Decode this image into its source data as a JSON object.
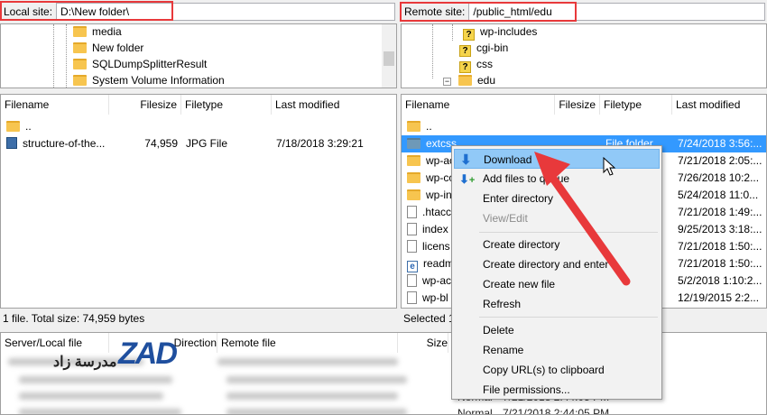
{
  "local_site": {
    "label": "Local site:",
    "path": "D:\\New folder\\"
  },
  "remote_site": {
    "label": "Remote site:",
    "path": "/public_html/edu"
  },
  "local_tree": [
    "media",
    "New folder",
    "SQLDumpSplitterResult",
    "System Volume Information"
  ],
  "remote_tree": [
    "wp-includes",
    "cgi-bin",
    "css",
    "edu"
  ],
  "local_list": {
    "columns": [
      "Filename",
      "Filesize",
      "Filetype",
      "Last modified"
    ],
    "rows": [
      {
        "name": "..",
        "size": "",
        "type": "",
        "modified": ""
      },
      {
        "name": "structure-of-the...",
        "size": "74,959",
        "type": "JPG File",
        "modified": "7/18/2018 3:29:21"
      }
    ],
    "status": "1 file. Total size: 74,959 bytes"
  },
  "remote_list": {
    "columns": [
      "Filename",
      "Filesize",
      "Filetype",
      "Last modified"
    ],
    "rows": [
      {
        "name": "..",
        "type": "",
        "modified": ""
      },
      {
        "name": "extcss",
        "type": "File folder",
        "modified": "7/24/2018 3:56:..."
      },
      {
        "name": "wp-ac",
        "type": "",
        "modified": "7/21/2018 2:05:..."
      },
      {
        "name": "wp-co",
        "type": "",
        "modified": "7/26/2018 10:2..."
      },
      {
        "name": "wp-in",
        "type": "",
        "modified": "5/24/2018 11:0..."
      },
      {
        "name": ".htacc",
        "type": "",
        "modified": "7/21/2018 1:49:..."
      },
      {
        "name": "index",
        "type": "",
        "modified": "9/25/2013 3:18:..."
      },
      {
        "name": "licens",
        "type": "",
        "modified": "7/21/2018 1:50:..."
      },
      {
        "name": "readm",
        "type": "",
        "modified": "7/21/2018 1:50:..."
      },
      {
        "name": "wp-ac",
        "type": "",
        "modified": "5/2/2018 1:10:2..."
      },
      {
        "name": "wp-bl",
        "type": "",
        "modified": "12/19/2015 2:2..."
      }
    ],
    "status": "Selected 1"
  },
  "queue": {
    "columns": [
      "Server/Local file",
      "Direction",
      "Remote file",
      "Size"
    ],
    "partial_text": [
      "Normal",
      "7/21/2018 2:44:05 PM",
      "Normal",
      "7/21/2018 2:44:05 PM"
    ]
  },
  "context_menu": {
    "items": [
      "Download",
      "Add files to queue",
      "Enter directory",
      "View/Edit",
      "Create directory",
      "Create directory and enter it",
      "Create new file",
      "Refresh",
      "Delete",
      "Rename",
      "Copy URL(s) to clipboard",
      "File permissions..."
    ]
  },
  "logo": {
    "text": "مدرسة زاد",
    "mark": "ZAD"
  },
  "colors": {
    "highlight": "#3399ff",
    "menu_hover": "#91c9f7",
    "annotation": "#e8393b"
  }
}
